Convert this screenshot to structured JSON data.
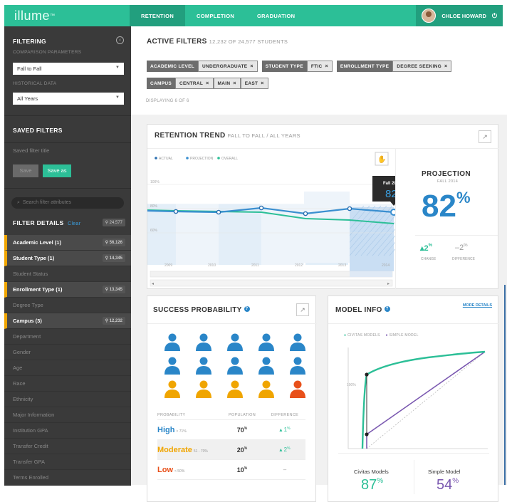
{
  "header": {
    "logo": "illume",
    "logo_tm": "™",
    "tabs": [
      "RETENTION",
      "COMPLETION",
      "GRADUATION"
    ],
    "user": "CHLOE HOWARD",
    "power_icon": "power-icon"
  },
  "sidebar": {
    "filtering_title": "FILTERING",
    "comparison_label": "COMPARISON PARAMETERS",
    "comparison_value": "Fall to Fall",
    "historical_label": "HISTORICAL DATA",
    "historical_value": "All Years",
    "saved_title": "SAVED FILTERS",
    "saved_placeholder": "Saved filter title",
    "save_btn": "Save",
    "saveas_btn": "Save as",
    "search_placeholder": "Search filter attributes",
    "details_title": "FILTER DETAILS",
    "clear": "Clear",
    "total": "24,577",
    "items": [
      {
        "label": "Academic Level  (1)",
        "count": "56,126",
        "selected": true
      },
      {
        "label": "Student Type  (1)",
        "count": "14,345",
        "selected": true
      },
      {
        "label": "Student Status",
        "count": "",
        "selected": false
      },
      {
        "label": "Enrollment Type  (1)",
        "count": "13,345",
        "selected": true
      },
      {
        "label": "Degree Type",
        "count": "",
        "selected": false
      },
      {
        "label": "Campus (3)",
        "count": "12,232",
        "selected": true
      },
      {
        "label": "Department",
        "count": "",
        "selected": false
      },
      {
        "label": "Gender",
        "count": "",
        "selected": false
      },
      {
        "label": "Age",
        "count": "",
        "selected": false
      },
      {
        "label": "Race",
        "count": "",
        "selected": false
      },
      {
        "label": "Ethnicity",
        "count": "",
        "selected": false
      },
      {
        "label": "Major Information",
        "count": "",
        "selected": false
      },
      {
        "label": "Institution GPA",
        "count": "",
        "selected": false
      },
      {
        "label": "Transfer Credit",
        "count": "",
        "selected": false
      },
      {
        "label": "Transfer GPA",
        "count": "",
        "selected": false
      },
      {
        "label": "Terms Enrolled",
        "count": "",
        "selected": false
      }
    ]
  },
  "active_filters": {
    "title": "ACTIVE FILTERS",
    "subtitle": "12,232 OF 24,577 STUDENTS",
    "displaying": "DISPLAYING 6 OF 6",
    "row1": [
      {
        "name": "ACADEMIC LEVEL",
        "values": [
          "UNDERGRADUATE"
        ]
      },
      {
        "name": "STUDENT TYPE",
        "values": [
          "FTIC"
        ]
      },
      {
        "name": "ENROLLMENT TYPE",
        "values": [
          "DEGREE SEEKING"
        ]
      }
    ],
    "row2": [
      {
        "name": "CAMPUS",
        "values": [
          "CENTRAL",
          "MAIN",
          "EAST"
        ]
      }
    ]
  },
  "retention": {
    "title": "RETENTION TREND",
    "subtitle": "FALL TO FALL / ALL YEARS",
    "legend": [
      "ACTUAL",
      "PROJECTION",
      "OVERALL"
    ],
    "tooltip_label": "Fall 2014",
    "tooltip_value": "82",
    "years": [
      "2009",
      "2010",
      "2011",
      "2012",
      "2013",
      "2014"
    ],
    "y_ticks": [
      "100%",
      "80%",
      "60%"
    ],
    "projection_title": "PROJECTION",
    "projection_sub": "FALL 2014",
    "projection_value": "82",
    "change_value": "2",
    "change_label": "CHANGE",
    "difference_value": "2",
    "difference_label": "DIFFERENCE",
    "colors": {
      "actual": "#3a8fd0",
      "overall": "#2cbf97"
    }
  },
  "success": {
    "title": "SUCCESS PROBABILITY",
    "headers": [
      "PROBABILITY",
      "POPULATION",
      "DIFFERENCE"
    ],
    "rows": [
      {
        "label": "High",
        "range": "> 71%",
        "pop": "70",
        "diff": "1",
        "color": "#2a86c8"
      },
      {
        "label": "Moderate",
        "range": "51 - 70%",
        "pop": "20",
        "diff": "2",
        "color": "#f0a500"
      },
      {
        "label": "Low",
        "range": "< 50%",
        "pop": "10",
        "diff": "–",
        "color": "#e8501a"
      }
    ]
  },
  "model": {
    "title": "MODEL INFO",
    "more": "MORE DETAILS",
    "legend": [
      "CIVITAS MODELS",
      "SIMPLE MODEL"
    ],
    "y_tick": "100%",
    "civitas_label": "Civitas Models",
    "civitas_value": "87",
    "simple_label": "Simple Model",
    "simple_value": "54",
    "colors": {
      "civitas": "#2cbf97",
      "simple": "#7a58b0"
    }
  }
}
